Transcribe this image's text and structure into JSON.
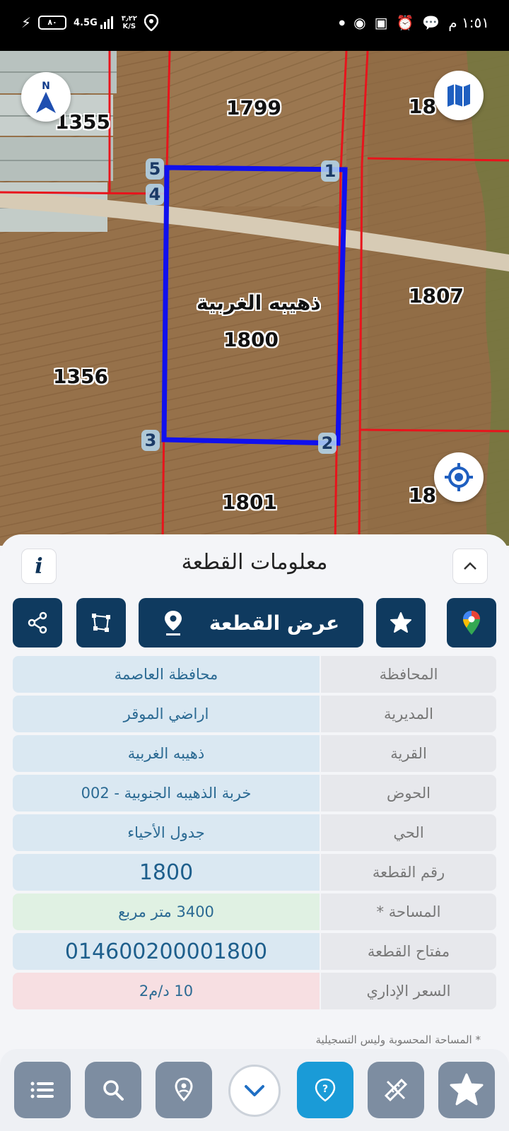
{
  "status_bar": {
    "time": "١:٥١ م",
    "network": "4.5G",
    "battery": "٨٠",
    "speed_value": "٣٫٢٢",
    "speed_unit": "K/S"
  },
  "map": {
    "north_label": "N",
    "selected_parcel": {
      "village": "ذهيبه الغربية",
      "number": "1800"
    },
    "neighbor_parcels": [
      "1799",
      "1355",
      "1356",
      "1807",
      "1801",
      "18",
      "18"
    ],
    "vertices": [
      "1",
      "2",
      "3",
      "4",
      "5"
    ],
    "icons": [
      "north-arrow-icon",
      "map-layers-icon",
      "locate-me-icon"
    ]
  },
  "panel": {
    "title": "معلومات القطعة",
    "view_parcel_button": "عرض القطعة",
    "action_icons": [
      "google-maps-icon",
      "favorite-star-icon",
      "view-parcel-pin-icon",
      "polygon-icon",
      "share-icon"
    ],
    "rows": [
      {
        "key": "المحافظة",
        "value": "محافظة العاصمة"
      },
      {
        "key": "المديرية",
        "value": "اراضي الموقر"
      },
      {
        "key": "القرية",
        "value": "ذهيبه الغربية"
      },
      {
        "key": "الحوض",
        "value": "خربة الذهيبه الجنوبية - 002"
      },
      {
        "key": "الحي",
        "value": "جدول الأحياء"
      },
      {
        "key": "رقم القطعة",
        "value": "1800"
      },
      {
        "key": "المساحة *",
        "value": "3400  متر مربع"
      },
      {
        "key": "مفتاح القطعة",
        "value": "014600200001800"
      },
      {
        "key": "السعر الإداري",
        "value": "10 د/م2"
      }
    ],
    "footnote": "* المساحة المحسوبة وليس التسجيلية"
  },
  "bottom_nav": {
    "icons": [
      "list-icon",
      "search-icon",
      "location-pin-icon",
      "collapse-chevron-icon",
      "help-icon",
      "measure-icon",
      "favorites-icon"
    ]
  },
  "colors": {
    "primary": "#0f3a5f",
    "parcel_outline": "#1010ee",
    "boundary": "#e8141c",
    "active_nav": "#1a9bd7",
    "value_blue": "#dae8f2",
    "value_green": "#e0f1e3",
    "value_red": "#f7dfe2"
  }
}
